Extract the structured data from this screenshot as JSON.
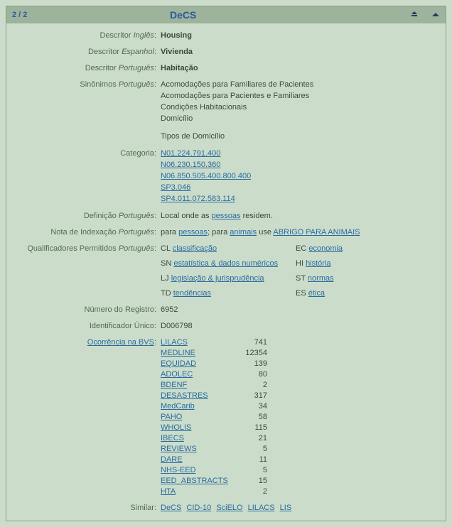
{
  "header": {
    "pager": "2 / 2",
    "title": "DeCS"
  },
  "labels": {
    "descriptor": "Descritor",
    "lang_en": "Inglês",
    "lang_es": "Espanhol",
    "lang_pt": "Português",
    "synonyms": "Sinônimos",
    "category": "Categoria",
    "definition": "Definição",
    "index_note": "Nota de Indexação",
    "qualifiers": "Qualificadores Permitidos",
    "record_number": "Número do Registro",
    "unique_id": "Identificador Único",
    "occurrence": "Ocorrência na BVS",
    "similar": "Similar"
  },
  "descriptor": {
    "en": "Housing",
    "es": "Vivienda",
    "pt": "Habitação"
  },
  "synonyms_pt": [
    "Acomodações para Familiares de Pacientes",
    "Acomodações para Pacientes e Familiares",
    "Condições Habitacionais",
    "Domicílio",
    "Tipos de Domicílio"
  ],
  "categories": [
    "N01.224.791.400",
    "N06.230.150.360",
    "N06.850.505.400.800.400",
    "SP3.046",
    "SP4.011.072.583.114"
  ],
  "definition_pt": {
    "pre": "Local onde as ",
    "link": "pessoas",
    "post": " residem."
  },
  "index_note_pt": {
    "t1": "para ",
    "link1": "pessoas",
    "t2": "; para ",
    "link2": "animais",
    "t3": " use ",
    "link3": "ABRIGO PARA ANIMAIS"
  },
  "qualifiers": [
    {
      "abbr": "CL",
      "label": "classificação"
    },
    {
      "abbr": "EC",
      "label": "economia"
    },
    {
      "abbr": "SN",
      "label": "estatística & dados numéricos"
    },
    {
      "abbr": "HI",
      "label": "história"
    },
    {
      "abbr": "LJ",
      "label": "legislação & jurisprudência"
    },
    {
      "abbr": "ST",
      "label": "normas"
    },
    {
      "abbr": "TD",
      "label": "tendências"
    },
    {
      "abbr": "ES",
      "label": "ética"
    }
  ],
  "record_number": "6952",
  "unique_id": "D006798",
  "occurrences": [
    {
      "name": "LILACS",
      "count": 741
    },
    {
      "name": "MEDLINE",
      "count": 12354
    },
    {
      "name": "EQUIDAD",
      "count": 139
    },
    {
      "name": "ADOLEC",
      "count": 80
    },
    {
      "name": "BDENF",
      "count": 2
    },
    {
      "name": "DESASTRES",
      "count": 317
    },
    {
      "name": "MedCarib",
      "count": 34
    },
    {
      "name": "PAHO",
      "count": 58
    },
    {
      "name": "WHOLIS",
      "count": 115
    },
    {
      "name": "IBECS",
      "count": 21
    },
    {
      "name": "REVIEWS",
      "count": 5
    },
    {
      "name": "DARE",
      "count": 11
    },
    {
      "name": "NHS-EED",
      "count": 5
    },
    {
      "name": "EED_ABSTRACTS",
      "count": 15
    },
    {
      "name": "HTA",
      "count": 2
    }
  ],
  "similar": [
    "DeCS",
    "CID-10",
    "SciELO",
    "LILACS",
    "LIS"
  ]
}
